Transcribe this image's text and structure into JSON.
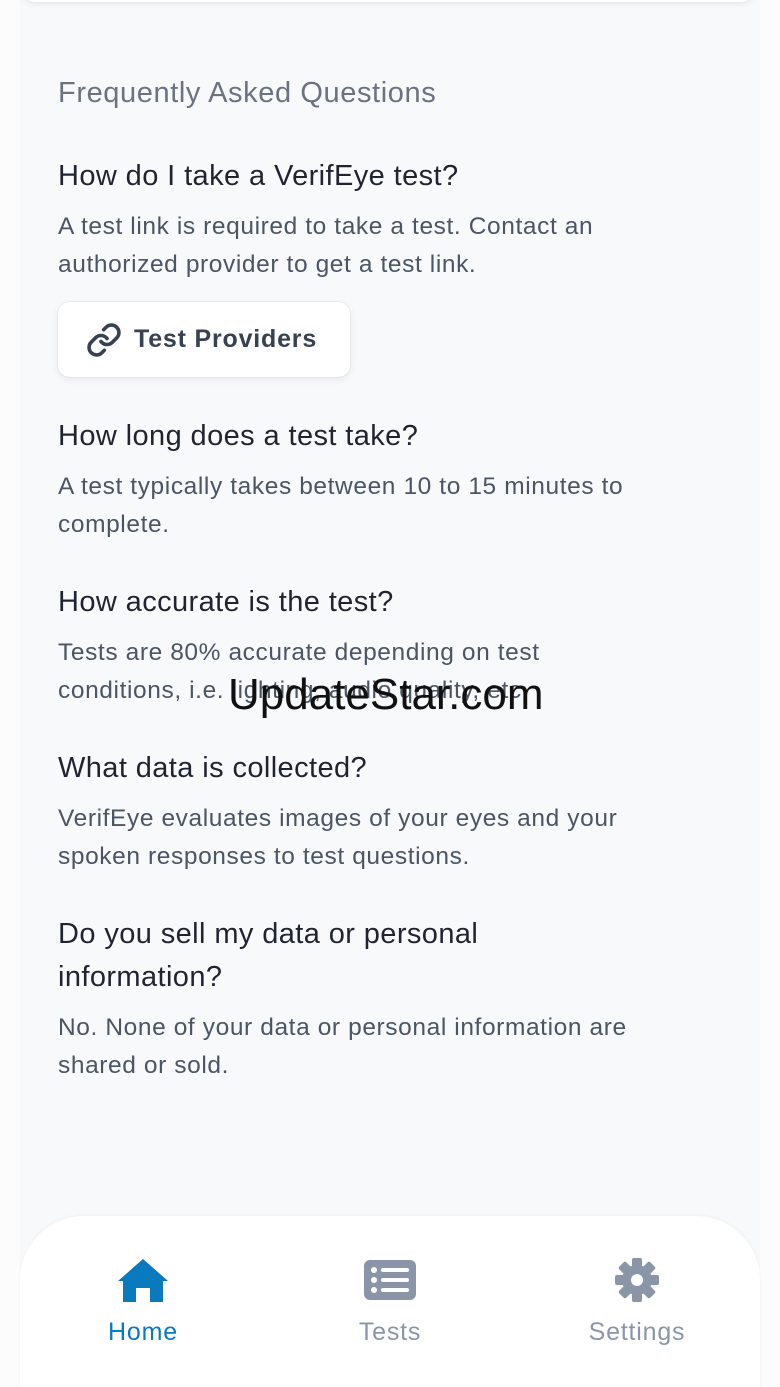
{
  "faq": {
    "title": "Frequently Asked Questions",
    "items": [
      {
        "question": "How do I take a VerifEye test?",
        "answer_line1": "A test link is required to take a test. Contact an",
        "answer_line2": "authorized provider to get a test link."
      },
      {
        "question": "How long does a test take?",
        "answer_line1": "A test typically takes between 10 to 15 minutes to",
        "answer_line2": "complete."
      },
      {
        "question": "How accurate is the test?",
        "answer_line1": "Tests are 80% accurate depending on test",
        "answer_line2": "conditions, i.e. lighting, audio quality, etc."
      },
      {
        "question": "What data is collected?",
        "answer_line1": "VerifEye evaluates images of your eyes and your",
        "answer_line2": "spoken responses to test questions."
      },
      {
        "question_line1": "Do you sell my data or personal",
        "question_line2": "information?",
        "answer_line1": "No. None of your data or personal information are",
        "answer_line2": "shared or sold."
      }
    ],
    "providers_button": {
      "label": "Test Providers",
      "icon": "link-icon"
    }
  },
  "watermark": "UpdateStar.com",
  "tabbar": {
    "tabs": [
      {
        "label": "Home",
        "icon": "home-icon",
        "active": true
      },
      {
        "label": "Tests",
        "icon": "list-icon",
        "active": false
      },
      {
        "label": "Settings",
        "icon": "gear-icon",
        "active": false
      }
    ]
  },
  "colors": {
    "accent": "#0a7abf",
    "inactive": "#8a96a8",
    "heading": "#1f2430",
    "body_text": "#4b5563",
    "title_muted": "#6b7280"
  }
}
